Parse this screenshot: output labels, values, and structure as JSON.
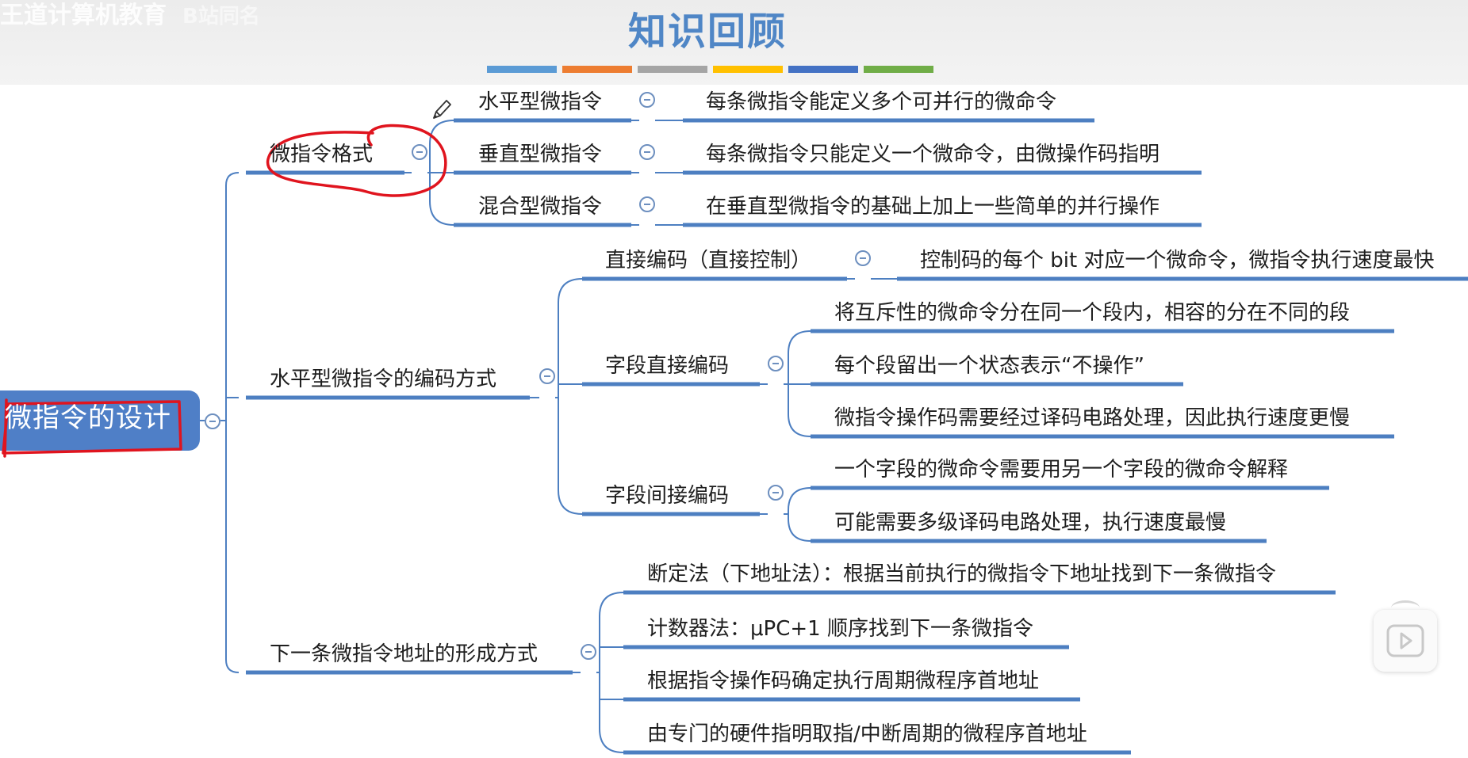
{
  "header": {
    "watermark": "王道计算机教育",
    "watermark_sub": "B站同名",
    "title": "知识回顾",
    "bar_colors": [
      "#5b9bd5",
      "#ed7d31",
      "#a5a5a5",
      "#ffc000",
      "#4472c4",
      "#70ad47"
    ]
  },
  "colors": {
    "line": "#4d7fc1",
    "root_fill": "#4f7fc7",
    "annotation": "#e0141e"
  },
  "mindmap": {
    "root": "微指令的设计",
    "branches": [
      {
        "label": "微指令格式",
        "children": [
          {
            "label": "水平型微指令",
            "note": "每条微指令能定义多个可并行的微命令"
          },
          {
            "label": "垂直型微指令",
            "note": "每条微指令只能定义一个微命令，由微操作码指明"
          },
          {
            "label": "混合型微指令",
            "note": "在垂直型微指令的基础上加上一些简单的并行操作"
          }
        ]
      },
      {
        "label": "水平型微指令的编码方式",
        "children": [
          {
            "label": "直接编码（直接控制）",
            "notes": [
              "控制码的每个 bit 对应一个微命令，微指令执行速度最快"
            ]
          },
          {
            "label": "字段直接编码",
            "notes": [
              "将互斥性的微命令分在同一个段内，相容的分在不同的段",
              "每个段留出一个状态表示“不操作”",
              "微指令操作码需要经过译码电路处理，因此执行速度更慢"
            ]
          },
          {
            "label": "字段间接编码",
            "notes": [
              "一个字段的微命令需要用另一个字段的微命令解释",
              "可能需要多级译码电路处理，执行速度最慢"
            ]
          }
        ]
      },
      {
        "label": "下一条微指令地址的形成方式",
        "children": [
          {
            "label": "断定法（下地址法）：根据当前执行的微指令下地址找到下一条微指令"
          },
          {
            "label": "计数器法：μPC+1 顺序找到下一条微指令"
          },
          {
            "label": "根据指令操作码确定执行周期微程序首地址"
          },
          {
            "label": "由专门的硬件指明取指/中断周期的微程序首地址"
          }
        ]
      }
    ]
  },
  "overlay": {
    "pencil_icon": "pencil-icon",
    "video_icon": "play-icon"
  }
}
